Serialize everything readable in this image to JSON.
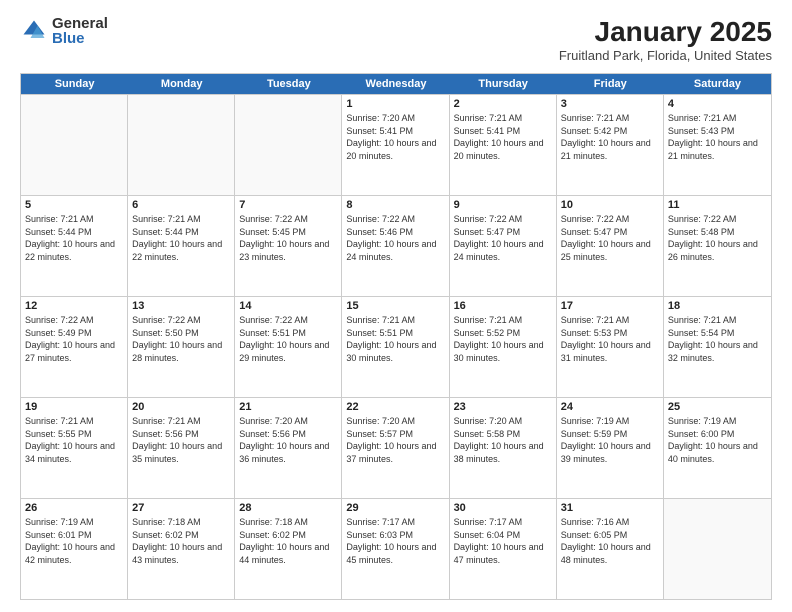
{
  "logo": {
    "general": "General",
    "blue": "Blue"
  },
  "header": {
    "title": "January 2025",
    "subtitle": "Fruitland Park, Florida, United States"
  },
  "days": [
    "Sunday",
    "Monday",
    "Tuesday",
    "Wednesday",
    "Thursday",
    "Friday",
    "Saturday"
  ],
  "weeks": [
    [
      {
        "day": "",
        "sunrise": "",
        "sunset": "",
        "daylight": ""
      },
      {
        "day": "",
        "sunrise": "",
        "sunset": "",
        "daylight": ""
      },
      {
        "day": "",
        "sunrise": "",
        "sunset": "",
        "daylight": ""
      },
      {
        "day": "1",
        "sunrise": "Sunrise: 7:20 AM",
        "sunset": "Sunset: 5:41 PM",
        "daylight": "Daylight: 10 hours and 20 minutes."
      },
      {
        "day": "2",
        "sunrise": "Sunrise: 7:21 AM",
        "sunset": "Sunset: 5:41 PM",
        "daylight": "Daylight: 10 hours and 20 minutes."
      },
      {
        "day": "3",
        "sunrise": "Sunrise: 7:21 AM",
        "sunset": "Sunset: 5:42 PM",
        "daylight": "Daylight: 10 hours and 21 minutes."
      },
      {
        "day": "4",
        "sunrise": "Sunrise: 7:21 AM",
        "sunset": "Sunset: 5:43 PM",
        "daylight": "Daylight: 10 hours and 21 minutes."
      }
    ],
    [
      {
        "day": "5",
        "sunrise": "Sunrise: 7:21 AM",
        "sunset": "Sunset: 5:44 PM",
        "daylight": "Daylight: 10 hours and 22 minutes."
      },
      {
        "day": "6",
        "sunrise": "Sunrise: 7:21 AM",
        "sunset": "Sunset: 5:44 PM",
        "daylight": "Daylight: 10 hours and 22 minutes."
      },
      {
        "day": "7",
        "sunrise": "Sunrise: 7:22 AM",
        "sunset": "Sunset: 5:45 PM",
        "daylight": "Daylight: 10 hours and 23 minutes."
      },
      {
        "day": "8",
        "sunrise": "Sunrise: 7:22 AM",
        "sunset": "Sunset: 5:46 PM",
        "daylight": "Daylight: 10 hours and 24 minutes."
      },
      {
        "day": "9",
        "sunrise": "Sunrise: 7:22 AM",
        "sunset": "Sunset: 5:47 PM",
        "daylight": "Daylight: 10 hours and 24 minutes."
      },
      {
        "day": "10",
        "sunrise": "Sunrise: 7:22 AM",
        "sunset": "Sunset: 5:47 PM",
        "daylight": "Daylight: 10 hours and 25 minutes."
      },
      {
        "day": "11",
        "sunrise": "Sunrise: 7:22 AM",
        "sunset": "Sunset: 5:48 PM",
        "daylight": "Daylight: 10 hours and 26 minutes."
      }
    ],
    [
      {
        "day": "12",
        "sunrise": "Sunrise: 7:22 AM",
        "sunset": "Sunset: 5:49 PM",
        "daylight": "Daylight: 10 hours and 27 minutes."
      },
      {
        "day": "13",
        "sunrise": "Sunrise: 7:22 AM",
        "sunset": "Sunset: 5:50 PM",
        "daylight": "Daylight: 10 hours and 28 minutes."
      },
      {
        "day": "14",
        "sunrise": "Sunrise: 7:22 AM",
        "sunset": "Sunset: 5:51 PM",
        "daylight": "Daylight: 10 hours and 29 minutes."
      },
      {
        "day": "15",
        "sunrise": "Sunrise: 7:21 AM",
        "sunset": "Sunset: 5:51 PM",
        "daylight": "Daylight: 10 hours and 30 minutes."
      },
      {
        "day": "16",
        "sunrise": "Sunrise: 7:21 AM",
        "sunset": "Sunset: 5:52 PM",
        "daylight": "Daylight: 10 hours and 30 minutes."
      },
      {
        "day": "17",
        "sunrise": "Sunrise: 7:21 AM",
        "sunset": "Sunset: 5:53 PM",
        "daylight": "Daylight: 10 hours and 31 minutes."
      },
      {
        "day": "18",
        "sunrise": "Sunrise: 7:21 AM",
        "sunset": "Sunset: 5:54 PM",
        "daylight": "Daylight: 10 hours and 32 minutes."
      }
    ],
    [
      {
        "day": "19",
        "sunrise": "Sunrise: 7:21 AM",
        "sunset": "Sunset: 5:55 PM",
        "daylight": "Daylight: 10 hours and 34 minutes."
      },
      {
        "day": "20",
        "sunrise": "Sunrise: 7:21 AM",
        "sunset": "Sunset: 5:56 PM",
        "daylight": "Daylight: 10 hours and 35 minutes."
      },
      {
        "day": "21",
        "sunrise": "Sunrise: 7:20 AM",
        "sunset": "Sunset: 5:56 PM",
        "daylight": "Daylight: 10 hours and 36 minutes."
      },
      {
        "day": "22",
        "sunrise": "Sunrise: 7:20 AM",
        "sunset": "Sunset: 5:57 PM",
        "daylight": "Daylight: 10 hours and 37 minutes."
      },
      {
        "day": "23",
        "sunrise": "Sunrise: 7:20 AM",
        "sunset": "Sunset: 5:58 PM",
        "daylight": "Daylight: 10 hours and 38 minutes."
      },
      {
        "day": "24",
        "sunrise": "Sunrise: 7:19 AM",
        "sunset": "Sunset: 5:59 PM",
        "daylight": "Daylight: 10 hours and 39 minutes."
      },
      {
        "day": "25",
        "sunrise": "Sunrise: 7:19 AM",
        "sunset": "Sunset: 6:00 PM",
        "daylight": "Daylight: 10 hours and 40 minutes."
      }
    ],
    [
      {
        "day": "26",
        "sunrise": "Sunrise: 7:19 AM",
        "sunset": "Sunset: 6:01 PM",
        "daylight": "Daylight: 10 hours and 42 minutes."
      },
      {
        "day": "27",
        "sunrise": "Sunrise: 7:18 AM",
        "sunset": "Sunset: 6:02 PM",
        "daylight": "Daylight: 10 hours and 43 minutes."
      },
      {
        "day": "28",
        "sunrise": "Sunrise: 7:18 AM",
        "sunset": "Sunset: 6:02 PM",
        "daylight": "Daylight: 10 hours and 44 minutes."
      },
      {
        "day": "29",
        "sunrise": "Sunrise: 7:17 AM",
        "sunset": "Sunset: 6:03 PM",
        "daylight": "Daylight: 10 hours and 45 minutes."
      },
      {
        "day": "30",
        "sunrise": "Sunrise: 7:17 AM",
        "sunset": "Sunset: 6:04 PM",
        "daylight": "Daylight: 10 hours and 47 minutes."
      },
      {
        "day": "31",
        "sunrise": "Sunrise: 7:16 AM",
        "sunset": "Sunset: 6:05 PM",
        "daylight": "Daylight: 10 hours and 48 minutes."
      },
      {
        "day": "",
        "sunrise": "",
        "sunset": "",
        "daylight": ""
      }
    ]
  ]
}
